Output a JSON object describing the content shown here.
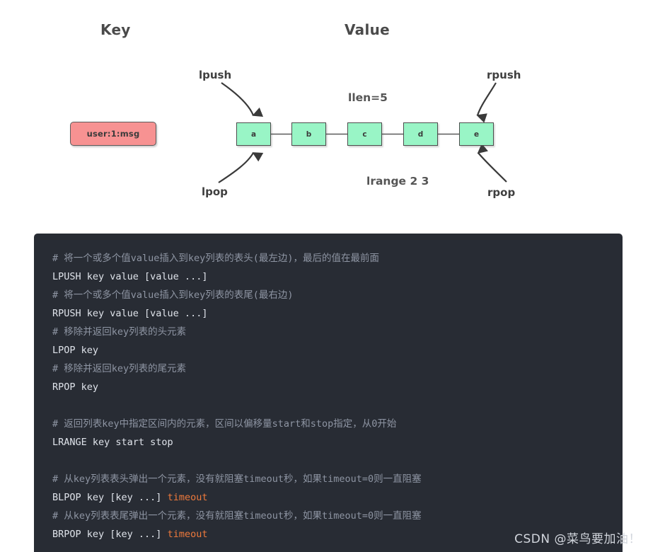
{
  "diagram": {
    "headings": {
      "key": "Key",
      "value": "Value"
    },
    "key_box": {
      "label": "user:1:msg",
      "color": "#f79292"
    },
    "node_color": "#99f5c6",
    "nodes": [
      {
        "label": "a"
      },
      {
        "label": "b"
      },
      {
        "label": "c"
      },
      {
        "label": "d"
      },
      {
        "label": "e"
      }
    ],
    "operations": {
      "lpush": "lpush",
      "lpop": "lpop",
      "rpush": "rpush",
      "rpop": "rpop"
    },
    "stats": {
      "llen": "llen=5",
      "lrange": "lrange 2 3"
    }
  },
  "code": {
    "background": "#282c34",
    "comment_color": "#8e95a3",
    "command_color": "#dfe3ea",
    "accent_color": "#ef7a3c",
    "lines": [
      {
        "type": "comment",
        "text": "# 将一个或多个值value插入到key列表的表头(最左边)，最后的值在最前面"
      },
      {
        "type": "cmd",
        "text": "LPUSH key value [value ...]"
      },
      {
        "type": "comment",
        "text": "# 将一个或多个值value插入到key列表的表尾(最右边)"
      },
      {
        "type": "cmd",
        "text": "RPUSH key value [value ...]"
      },
      {
        "type": "comment",
        "text": "# 移除并返回key列表的头元素"
      },
      {
        "type": "cmd",
        "text": "LPOP key"
      },
      {
        "type": "comment",
        "text": "# 移除并返回key列表的尾元素"
      },
      {
        "type": "cmd",
        "text": "RPOP key"
      },
      {
        "type": "blank",
        "text": ""
      },
      {
        "type": "comment",
        "text": "# 返回列表key中指定区间内的元素，区间以偏移量start和stop指定，从0开始"
      },
      {
        "type": "cmd",
        "text": "LRANGE key start stop"
      },
      {
        "type": "blank",
        "text": ""
      },
      {
        "type": "comment",
        "text": "# 从key列表表头弹出一个元素，没有就阻塞timeout秒，如果timeout=0则一直阻塞"
      },
      {
        "type": "cmd-accent",
        "text": "BLPOP key [key ...] ",
        "accent": "timeout"
      },
      {
        "type": "comment",
        "text": "# 从key列表表尾弹出一个元素，没有就阻塞timeout秒，如果timeout=0则一直阻塞"
      },
      {
        "type": "cmd-accent",
        "text": "BRPOP key [key ...] ",
        "accent": "timeout"
      }
    ]
  },
  "watermark": {
    "text": "CSDN @菜鸟要加油！"
  }
}
